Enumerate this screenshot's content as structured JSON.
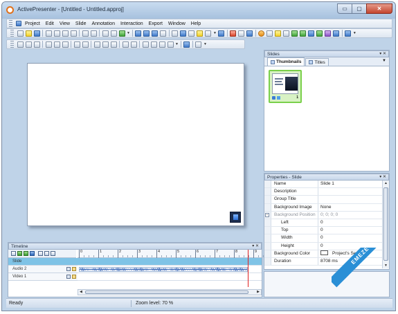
{
  "window": {
    "title": "ActivePresenter - [Untitled - Untitled.approj]",
    "min_symbol": "▭",
    "max_symbol": "▢",
    "close_symbol": "✕"
  },
  "menu": [
    "Project",
    "Edit",
    "View",
    "Slide",
    "Annotation",
    "Interaction",
    "Export",
    "Window",
    "Help"
  ],
  "timeline": {
    "title": "Timeline",
    "ruler_ticks": [
      "0",
      "1",
      "2",
      "3",
      "4",
      "5",
      "6",
      "7",
      "8",
      "9"
    ],
    "tracks": [
      {
        "label": "Slide",
        "selected": true
      },
      {
        "label": "Audio 2",
        "selected": false
      },
      {
        "label": "Video 1",
        "selected": false
      }
    ],
    "playhead_seconds": 8.7
  },
  "slides_panel": {
    "title": "Slides",
    "tabs": [
      {
        "label": "Thumbnails",
        "active": true
      },
      {
        "label": "Titles",
        "active": false
      }
    ],
    "thumbnail_number": "1"
  },
  "properties": {
    "title": "Properties - Slide",
    "rows": [
      {
        "name": "Name",
        "value": "Slide 1"
      },
      {
        "name": "Description",
        "value": ""
      },
      {
        "name": "Group Title",
        "value": ""
      },
      {
        "name": "Background Image",
        "value": "None"
      },
      {
        "name": "Background Position",
        "value": "0; 0; 0; 0",
        "disabled": true,
        "expander": true
      },
      {
        "name": "Left",
        "value": "0",
        "sub": true
      },
      {
        "name": "Top",
        "value": "0",
        "sub": true
      },
      {
        "name": "Width",
        "value": "0",
        "sub": true
      },
      {
        "name": "Height",
        "value": "0",
        "sub": true
      },
      {
        "name": "Background Color",
        "value": "Project's Setting",
        "swatch": "#ffffff"
      },
      {
        "name": "Duration",
        "value": "8708 ms"
      }
    ]
  },
  "status": {
    "state": "Ready",
    "zoom": "Zoom level:  70 %"
  },
  "watermark": "EMEZETA.COM",
  "colors": {
    "accent": "#2a8fd6",
    "selected_track": "#7fc3e6",
    "thumbnail_border": "#7ad04a",
    "playhead": "#e02020"
  }
}
